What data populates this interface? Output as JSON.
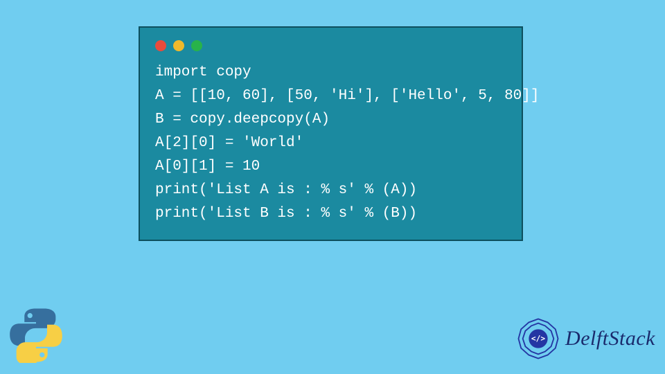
{
  "code": {
    "lines": [
      "import copy",
      "A = [[10, 60], [50, 'Hi'], ['Hello', 5, 80]]",
      "B = copy.deepcopy(A)",
      "A[2][0] = 'World'",
      "A[0][1] = 10",
      "print('List A is : % s' % (A))",
      "print('List B is : % s' % (B))"
    ]
  },
  "window": {
    "traffic_colors": {
      "red": "#e84b3c",
      "yellow": "#f0b92b",
      "green": "#28b34a"
    }
  },
  "brand": {
    "name": "DelftStack"
  }
}
